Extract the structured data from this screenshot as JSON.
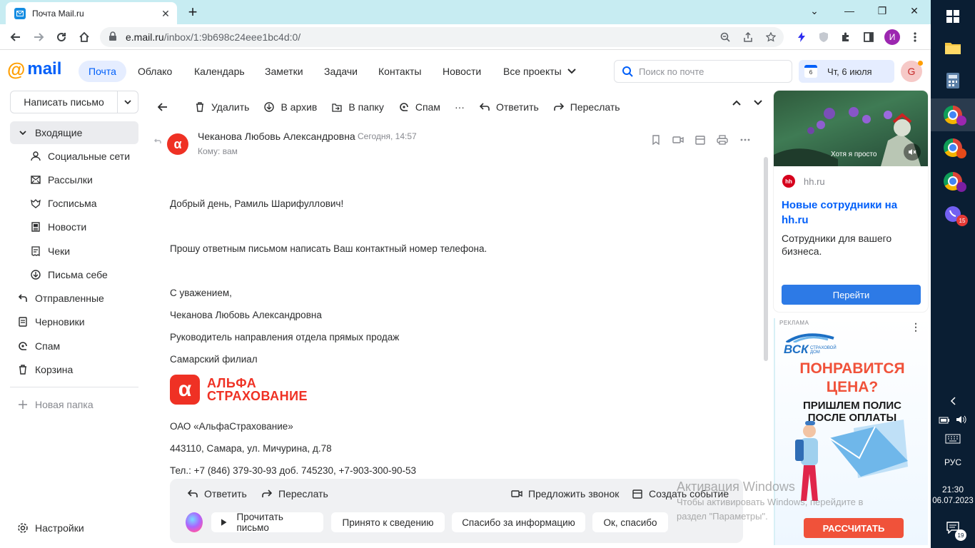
{
  "browser": {
    "tab_title": "Почта Mail.ru",
    "tab_close": "✕",
    "new_tab": "+",
    "url_host": "e.mail.ru",
    "url_path": "/inbox/1:9b698c24eee1bc4d:0/",
    "profile_initial": "И",
    "win_min": "⌄",
    "win_max": "—",
    "win_restore": "❐",
    "win_close": "✕"
  },
  "mail_header": {
    "logo_at": "@",
    "logo_word": "mail",
    "nav": [
      "Почта",
      "Облако",
      "Календарь",
      "Заметки",
      "Задачи",
      "Контакты",
      "Новости",
      "Все проекты"
    ],
    "search_placeholder": "Поиск по почте",
    "date_icon_day": "6",
    "date_label": "Чт, 6 июля",
    "user_initial": "G"
  },
  "sidebar": {
    "compose_label": "Написать письмо",
    "folders": [
      {
        "label": "Входящие"
      },
      {
        "label": "Социальные сети"
      },
      {
        "label": "Рассылки"
      },
      {
        "label": "Госписьма"
      },
      {
        "label": "Новости"
      },
      {
        "label": "Чеки"
      },
      {
        "label": "Письма себе"
      },
      {
        "label": "Отправленные"
      },
      {
        "label": "Черновики"
      },
      {
        "label": "Спам"
      },
      {
        "label": "Корзина"
      }
    ],
    "new_folder": "Новая папка",
    "settings": "Настройки"
  },
  "toolbar": {
    "delete": "Удалить",
    "archive": "В архив",
    "to_folder": "В папку",
    "spam": "Спам",
    "more": "···",
    "reply": "Ответить",
    "forward": "Переслать"
  },
  "message": {
    "sender_initial": "α",
    "sender": "Чеканова Любовь Александровна",
    "date": "Сегодня, 14:57",
    "to": "Кому: вам",
    "lines": [
      "Добрый день, Рамиль Шарифуллович!",
      "Прошу ответным письмом написать Ваш контактный номер телефона.",
      "С уважением,",
      "Чеканова Любовь Александровна",
      "Руководитель направления отдела прямых продаж",
      "Самарский филиал",
      "ОАО «АльфаСтрахование»",
      "443110, Самара, ул. Мичурина, д.78",
      "Тел.: +7 (846) 379-30-93  доб. 745230, +7-903-300-90-53"
    ],
    "logo_mark": "α",
    "logo_line1": "АЛЬФА",
    "logo_line2": "СТРАХОВАНИЕ"
  },
  "quick_reply": {
    "reply": "Ответить",
    "forward": "Переслать",
    "suggest_call": "Предложить звонок",
    "create_event": "Создать событие",
    "chips": [
      "Прочитать письмо",
      "Принято к сведению",
      "Спасибо за информацию",
      "Ок, спасибо"
    ]
  },
  "windows_activation": {
    "title": "Активация Windows",
    "line1": "Чтобы активировать Windows, перейдите в",
    "line2": "раздел \"Параметры\"."
  },
  "ad_hh": {
    "video_caption": "Хотя я просто",
    "brand_icon": "hh",
    "brand": "hh.ru",
    "headline": "Новые сотрудники на hh.ru",
    "description": "Сотрудники для вашего бизнеса.",
    "button": "Перейти"
  },
  "ad_vsk": {
    "label": "РЕКЛАМА",
    "menu": "⋮",
    "brand": "ВСК",
    "brand_sub": "СТРАХОВОЙ ДОМ",
    "headline_1": "ПОНРАВИТСЯ",
    "headline_2": "ЦЕНА?",
    "sub_1": "ПРИШЛЕМ ПОЛИС",
    "sub_2": "ПОСЛЕ ОПЛАТЫ",
    "button": "РАССЧИТАТЬ"
  },
  "taskbar": {
    "viber_badge": "15",
    "language": "РУС",
    "time": "21:30",
    "date": "06.07.2023",
    "notif_count": "19"
  }
}
